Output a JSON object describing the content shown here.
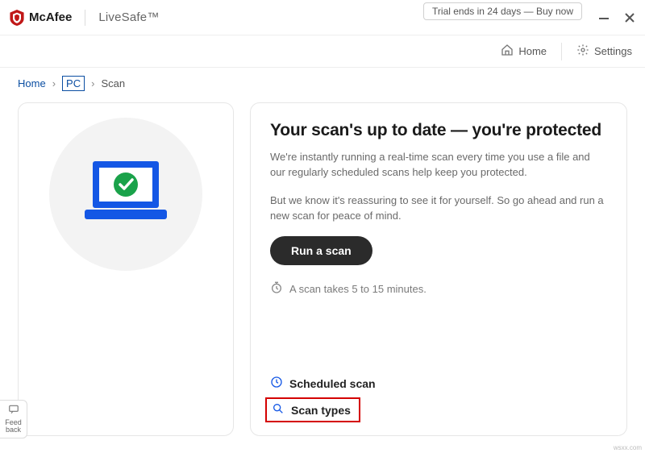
{
  "brand": {
    "name": "McAfee",
    "product": "LiveSafe™"
  },
  "titlebar": {
    "trial": "Trial ends in 24 days — Buy now"
  },
  "nav": {
    "home": "Home",
    "settings": "Settings"
  },
  "breadcrumb": {
    "home": "Home",
    "pc": "PC",
    "scan": "Scan"
  },
  "main": {
    "heading": "Your scan's up to date — you're protected",
    "para1": "We're instantly running a real-time scan every time you use a file and our regularly scheduled scans help keep you protected.",
    "para2": "But we know it's reassuring to see it for yourself. So go ahead and run a new scan for peace of mind.",
    "cta": "Run a scan",
    "hint": "A scan takes 5 to 15 minutes."
  },
  "links": {
    "scheduled": "Scheduled scan",
    "scan_types": "Scan types"
  },
  "feedback": {
    "line1": "Feed",
    "line2": "back"
  },
  "watermark": "wsxx.com"
}
